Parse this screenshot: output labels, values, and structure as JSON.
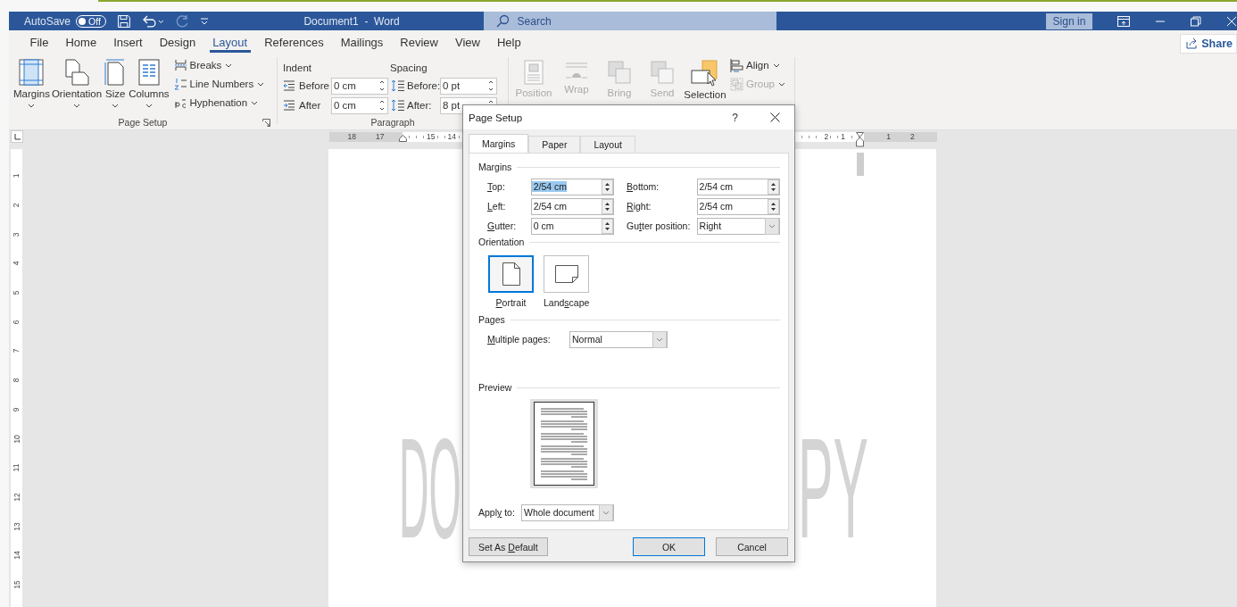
{
  "title_bar": {
    "autosave_label": "AutoSave",
    "autosave_toggle": {
      "label": "Off",
      "on": false
    },
    "document_title": "Document1  -  Word",
    "search": {
      "placeholder": "Search"
    },
    "sign_in": "Sign in"
  },
  "menu_tabs": [
    {
      "label": "File",
      "selected": false
    },
    {
      "label": "Home",
      "selected": false
    },
    {
      "label": "Insert",
      "selected": false
    },
    {
      "label": "Design",
      "selected": false
    },
    {
      "label": "Layout",
      "selected": true
    },
    {
      "label": "References",
      "selected": false
    },
    {
      "label": "Mailings",
      "selected": false
    },
    {
      "label": "Review",
      "selected": false
    },
    {
      "label": "View",
      "selected": false
    },
    {
      "label": "Help",
      "selected": false
    }
  ],
  "share": "Share",
  "ribbon": {
    "page_setup": {
      "large_buttons": [
        {
          "label": "Margins"
        },
        {
          "label": "Orientation"
        },
        {
          "label": "Size"
        },
        {
          "label": "Columns"
        }
      ],
      "small_buttons": [
        {
          "label": "Breaks"
        },
        {
          "label": "Line Numbers"
        },
        {
          "label": "Hyphenation"
        }
      ],
      "group_label": "Page Setup"
    },
    "paragraph": {
      "indent_title": "Indent",
      "spacing_title": "Spacing",
      "rows": [
        {
          "indent_label": "Before",
          "indent_value": "0 cm",
          "spacing_label": "Before:",
          "spacing_value": "0 pt"
        },
        {
          "indent_label": "After",
          "indent_value": "0 cm",
          "spacing_label": "After:",
          "spacing_value": "8 pt"
        }
      ],
      "group_label": "Paragraph"
    },
    "arrange": {
      "buttons": [
        {
          "label": "Position",
          "disabled": true
        },
        {
          "label": "Wrap",
          "disabled": true
        },
        {
          "label": "Bring",
          "disabled": true
        },
        {
          "label": "Send",
          "disabled": true
        },
        {
          "label": "Selection",
          "disabled": false
        }
      ],
      "small_buttons": [
        {
          "label": "Align",
          "disabled": false
        },
        {
          "label": "Group",
          "disabled": true
        }
      ]
    }
  },
  "ruler": {
    "left_numbers": [
      "18",
      "17",
      "15",
      "14"
    ],
    "right_numbers": [
      "2",
      "1"
    ],
    "far_right_numbers": [
      "1",
      "2"
    ]
  },
  "vertical_ruler": [
    "1",
    "2",
    "3",
    "4",
    "5",
    "6",
    "7",
    "8",
    "9",
    "10",
    "11",
    "12",
    "13",
    "14",
    "15"
  ],
  "watermark_parts": [
    "DO",
    "PY"
  ],
  "dialog": {
    "title": "Page Setup",
    "help": "?",
    "tabs": [
      {
        "label": "Margins",
        "selected": true
      },
      {
        "label": "Paper",
        "selected": false
      },
      {
        "label": "Layout",
        "selected": false
      }
    ],
    "margins_heading": "Margins",
    "margin_rows": [
      {
        "left": {
          "label": {
            "key": "T",
            "post": "op:"
          },
          "value": "2/54 cm",
          "text_selected": true
        },
        "right": {
          "kind": "spin",
          "label": {
            "key": "B",
            "post": "ottom:"
          },
          "value": "2/54 cm"
        }
      },
      {
        "left": {
          "label": {
            "key": "L",
            "post": "eft:"
          },
          "value": "2/54 cm",
          "text_selected": false
        },
        "right": {
          "kind": "spin",
          "label": {
            "key": "R",
            "post": "ight:"
          },
          "value": "2/54 cm"
        }
      },
      {
        "left": {
          "label": {
            "key": "G",
            "post": "utter:"
          },
          "value": "0 cm",
          "text_selected": false
        },
        "right": {
          "kind": "select",
          "label": {
            "pre": "Gu",
            "key": "t",
            "post": "ter position:"
          },
          "value": "Right"
        }
      }
    ],
    "orientation_heading": "Orientation",
    "orientations": [
      {
        "label": {
          "key": "P",
          "post": "ortrait"
        },
        "selected": true
      },
      {
        "label": {
          "pre": "Land",
          "key": "s",
          "post": "cape"
        },
        "selected": false
      }
    ],
    "pages_heading": "Pages",
    "multiple_pages": {
      "label": {
        "key": "M",
        "post": "ultiple pages:"
      },
      "value": "Normal"
    },
    "preview_heading": "Preview",
    "apply_to": {
      "label": {
        "pre": "Appl",
        "key": "y",
        "post": " to:"
      },
      "value": "Whole document"
    },
    "buttons": [
      {
        "label": {
          "pre": "Set As ",
          "key": "D",
          "post": "efault"
        },
        "default": false,
        "kind": "left"
      },
      {
        "label": {
          "pre": "OK"
        },
        "default": true,
        "kind": "right"
      },
      {
        "label": {
          "pre": "Cancel"
        },
        "default": false,
        "kind": "right"
      }
    ]
  }
}
